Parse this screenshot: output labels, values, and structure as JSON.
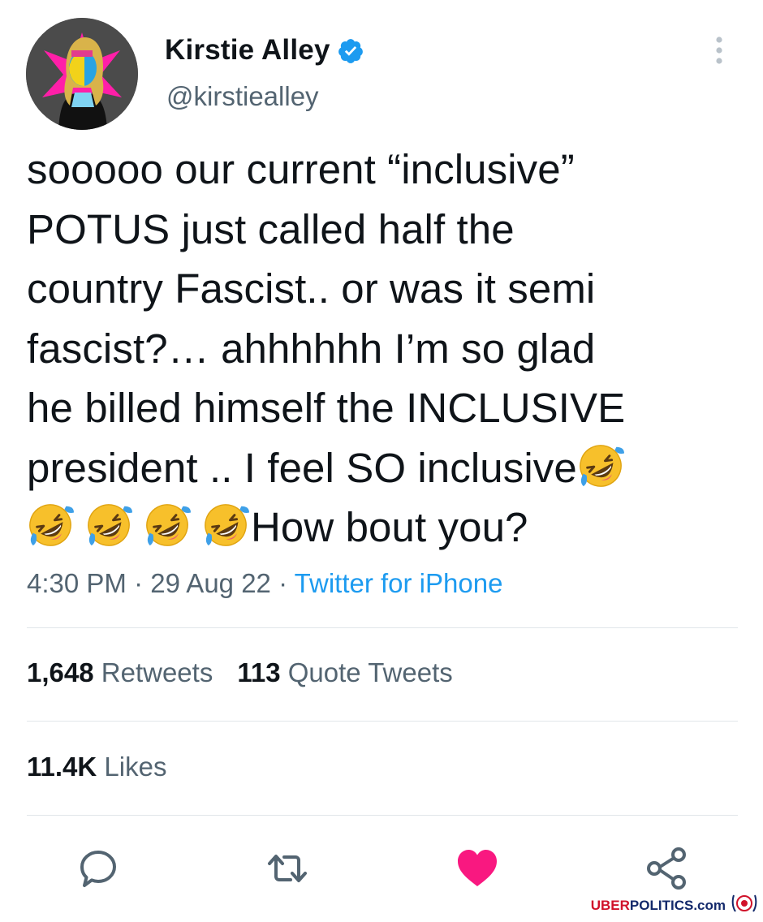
{
  "tweet": {
    "author": {
      "display_name": "Kirstie Alley",
      "handle": "@kirstiealley",
      "avatar_icon": "avatar",
      "verified_icon": "verified-badge-icon"
    },
    "text_lines": [
      "sooooo our current “inclusive”",
      "POTUS just called half the",
      "country Fascist.. or was it semi",
      "fascist?… ahhhhhh I’m so glad",
      "he billed himself the INCLUSIVE",
      "president .. I feel SO inclusive",
      "How bout you?"
    ],
    "emoji_name": "rolling-on-the-floor-laughing-emoji",
    "time": "4:30 PM",
    "separator": "·",
    "date": "29 Aug 22",
    "source": "Twitter for iPhone",
    "stats": {
      "retweets_count": "1,648",
      "retweets_label": "Retweets",
      "quotes_count": "113",
      "quotes_label": "Quote Tweets",
      "likes_count": "11.4K",
      "likes_label": "Likes"
    },
    "actions": [
      {
        "icon": "reply-icon"
      },
      {
        "icon": "retweet-icon"
      },
      {
        "icon": "like-icon",
        "state": "liked"
      },
      {
        "icon": "share-icon"
      }
    ]
  },
  "colors": {
    "text_primary": "#0f1419",
    "text_secondary": "#536471",
    "link": "#1d9bf0",
    "like": "#f91880",
    "divider": "#e1e6ea"
  },
  "watermark": {
    "part1": "UBER",
    "part2": "POLITICS.com"
  }
}
